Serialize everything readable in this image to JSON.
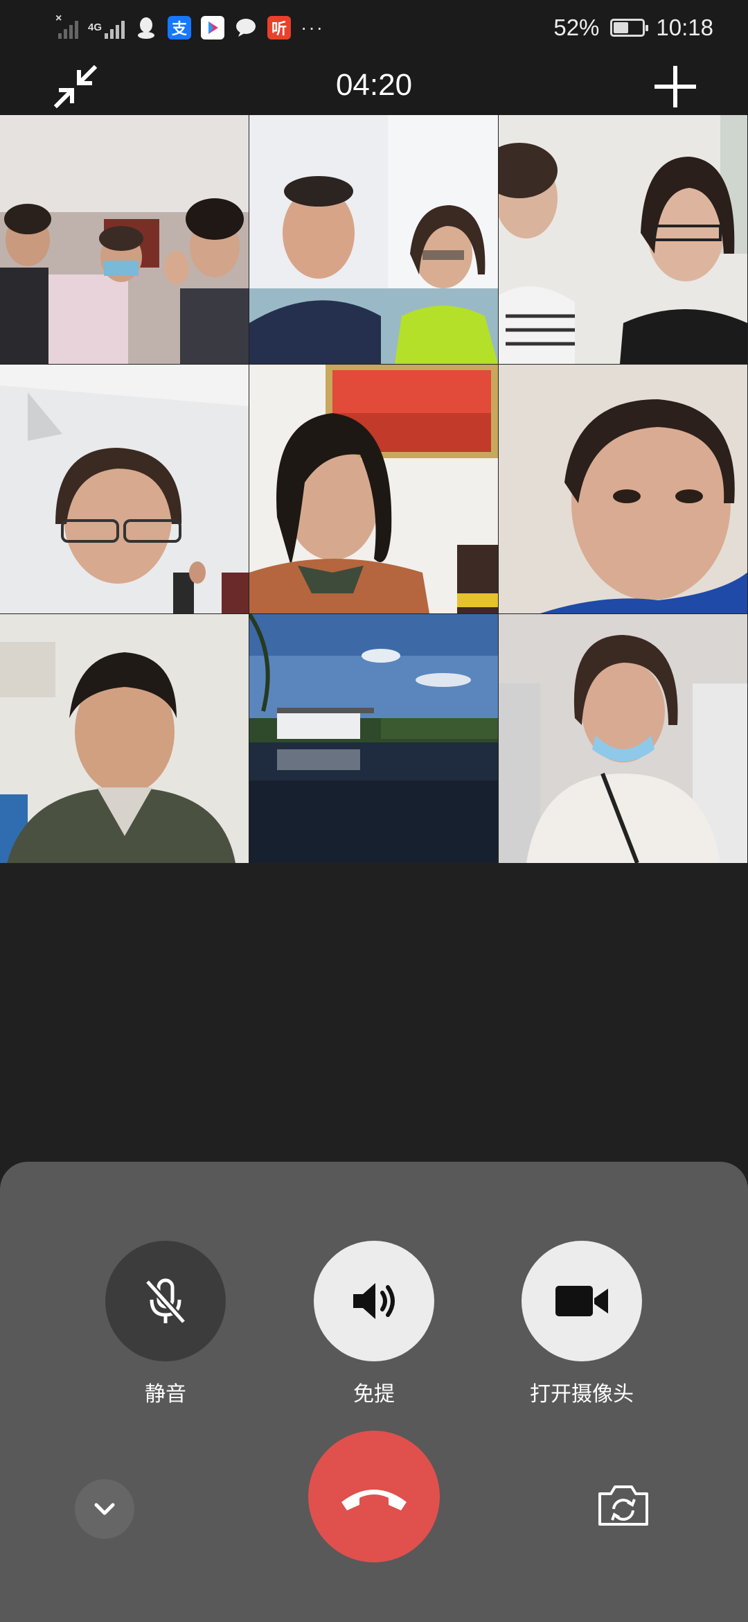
{
  "status_bar": {
    "network_type": "4G",
    "battery_percent": "52%",
    "battery_level": 0.52,
    "time": "10:18",
    "notification_icons": [
      "sim-off-signal-icon",
      "signal-4g-icon",
      "qq-icon",
      "alipay-icon",
      "youku-icon",
      "message-bubble-icon",
      "ting-app-icon",
      "more-dots-icon"
    ],
    "ting_label": "听",
    "alipay_label": "支",
    "more_label": "···"
  },
  "header": {
    "call_duration": "04:20",
    "left_icon": "minimize-arrows-icon",
    "right_icon": "add-participant-icon"
  },
  "participants_grid": {
    "rows": 3,
    "columns": 3,
    "tiles": [
      {
        "name": "participant-tile-1"
      },
      {
        "name": "participant-tile-2"
      },
      {
        "name": "participant-tile-3"
      },
      {
        "name": "participant-tile-4"
      },
      {
        "name": "participant-tile-5"
      },
      {
        "name": "participant-tile-6"
      },
      {
        "name": "participant-tile-7"
      },
      {
        "name": "participant-tile-8"
      },
      {
        "name": "participant-tile-9"
      }
    ]
  },
  "controls": {
    "mute_label": "静音",
    "speaker_label": "免提",
    "camera_label": "打开摄像头"
  },
  "colors": {
    "hangup": "#e0504d",
    "panel": "#595959",
    "background": "#202020",
    "toggle_active": "#ececec",
    "toggle_inactive": "#3c3c3c"
  }
}
